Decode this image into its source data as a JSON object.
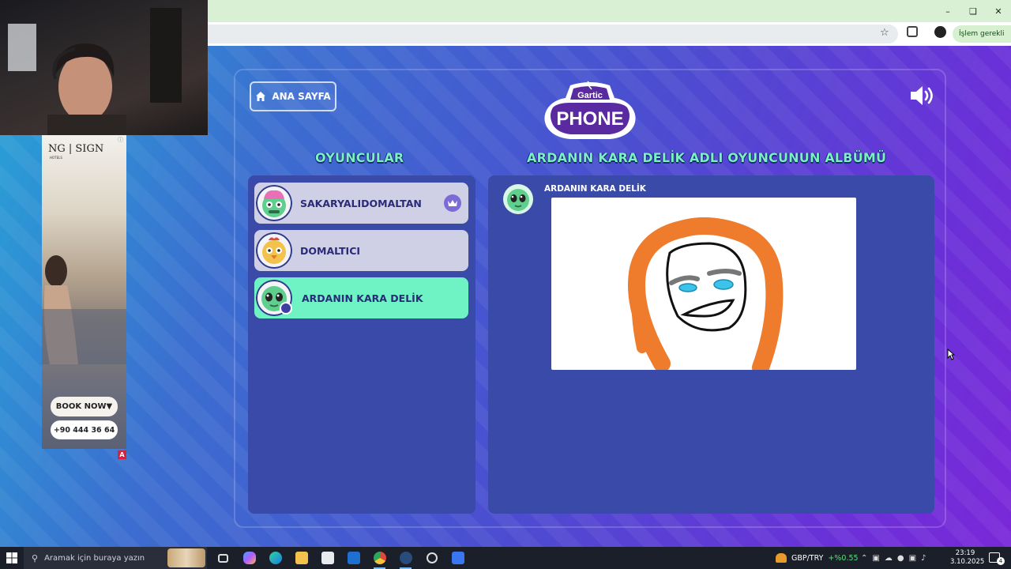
{
  "browser": {
    "action_pill_label": "İşlem gerekli",
    "window_controls": [
      "minimize-icon",
      "restore-icon",
      "close-icon"
    ]
  },
  "game": {
    "home_button_label": "ANA SAYFA",
    "logo_top": "Gartic",
    "logo_bottom": "PHONE",
    "players_heading": "OYUNCULAR",
    "album_heading": "ARDANIN KARA DELİK ADLI OYUNCUNUN ALBÜMÜ",
    "players": [
      {
        "name": "SAKARYALIDOMALTAN",
        "avatar": "pink-brain-zombie-avatar",
        "host": true
      },
      {
        "name": "DOMALTICI",
        "avatar": "chicken-avatar",
        "host": false
      },
      {
        "name": "ARDANIN KARA DELİK",
        "avatar": "green-alien-avatar",
        "host": false,
        "is_me": true
      }
    ],
    "album": {
      "author": "ARDANIN KARA DELİK",
      "drawing": "face-with-orange-hair-drawing"
    },
    "colors": {
      "heading": "#7cf0c0",
      "active_card": "#6ff2c4",
      "inactive_card": "#cfd0e6",
      "panel": "#3a4aa8"
    }
  },
  "ad": {
    "brand": "NG | SIGN",
    "brand_sub": "HOTELS",
    "book_label": "BOOK NOW▼",
    "phone_label": "+90 444 36 64",
    "adchoice": "A"
  },
  "taskbar": {
    "search_placeholder": "Aramak için buraya yazın",
    "ticker_pair": "GBP/TRY",
    "ticker_change": "+%0.55",
    "time": "23:19",
    "date": "3.10.2025",
    "notification_count": "4"
  }
}
